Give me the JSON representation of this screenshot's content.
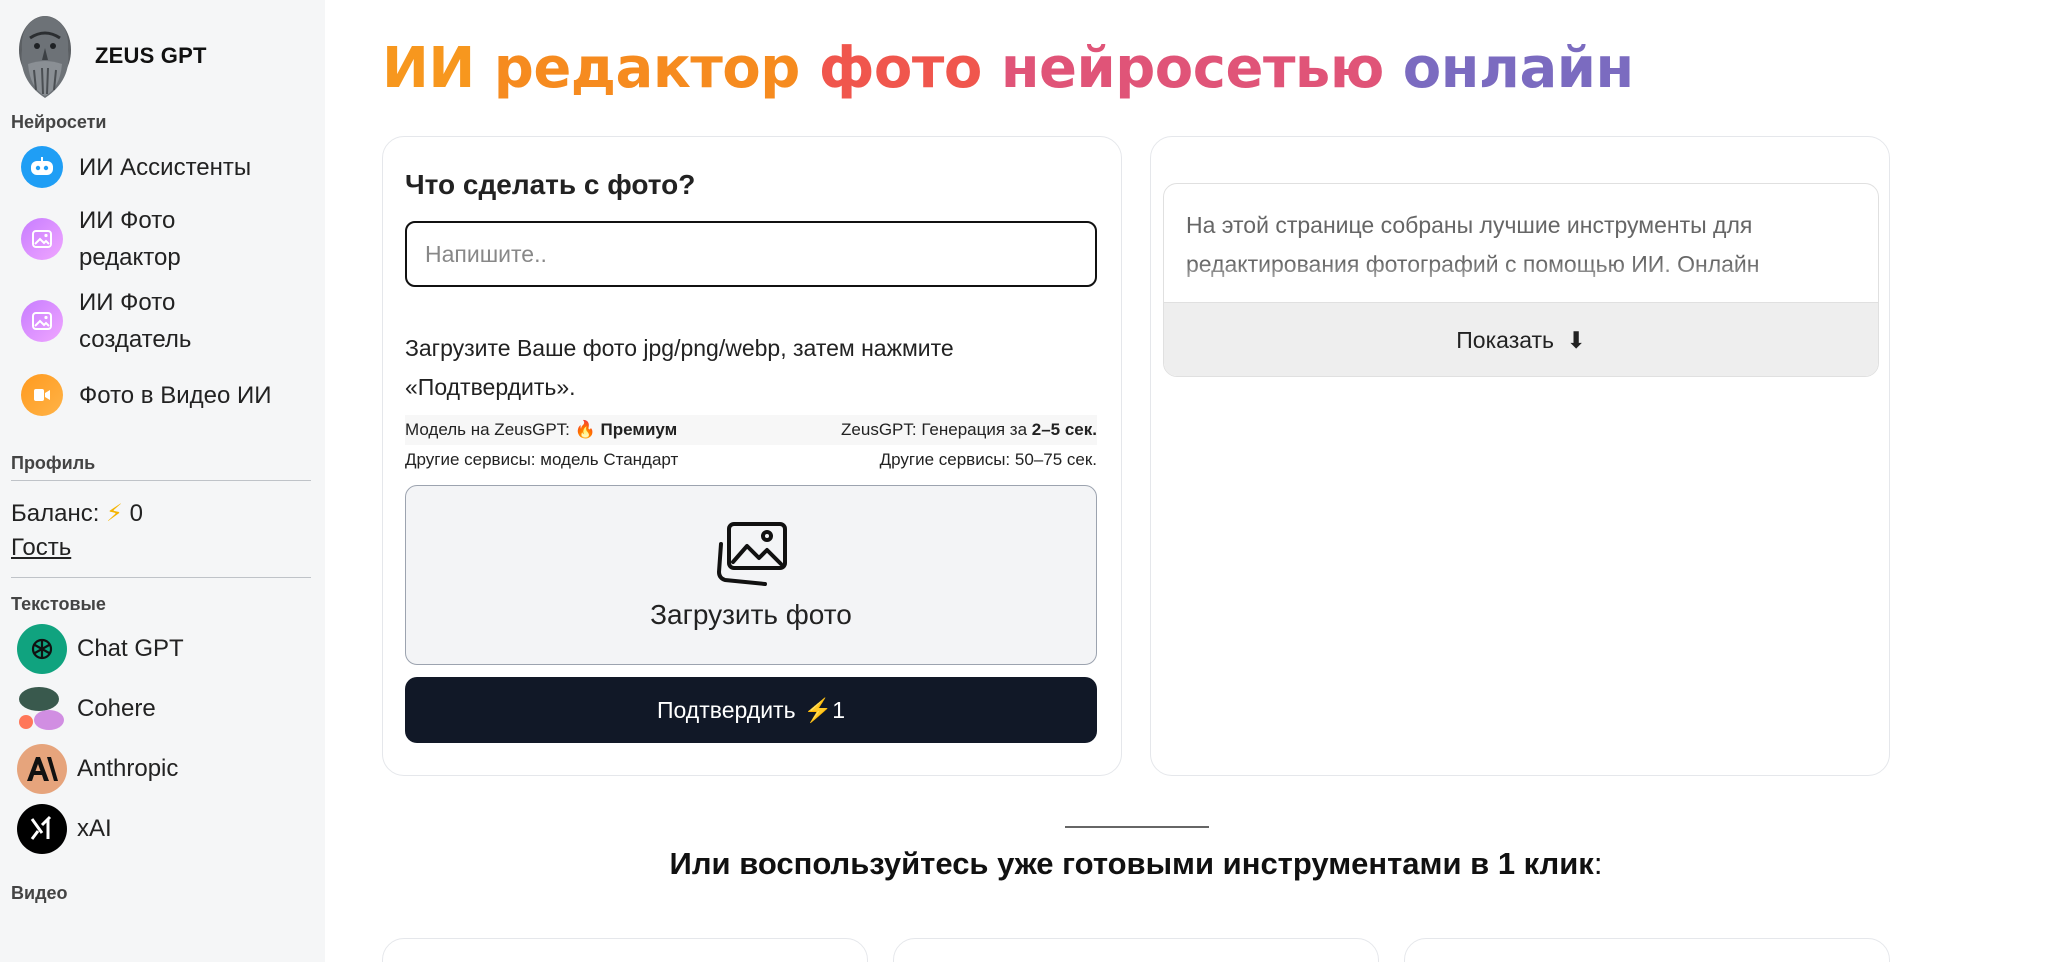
{
  "brand": {
    "name": "ZEUS GPT"
  },
  "sidebar": {
    "sections": {
      "neural": "Нейросети",
      "profile": "Профиль",
      "text": "Текстовые",
      "video": "Видео"
    },
    "nav": [
      {
        "label": "ИИ Ассистенты",
        "icon": "robot-icon"
      },
      {
        "label": "ИИ Фото редактор",
        "icon": "image-icon"
      },
      {
        "label": "ИИ Фото создатель",
        "icon": "image-icon"
      },
      {
        "label": "Фото в Видео ИИ",
        "icon": "video-icon"
      }
    ],
    "balance_label": "Баланс:",
    "balance_value": "0",
    "guest": "Гость",
    "tools": [
      {
        "label": "Chat GPT",
        "icon": "openai-icon"
      },
      {
        "label": "Cohere",
        "icon": "cohere-icon"
      },
      {
        "label": "Anthropic",
        "icon": "anthropic-icon"
      },
      {
        "label": "xAI",
        "icon": "xai-icon"
      }
    ]
  },
  "hero": {
    "words": [
      "ИИ",
      "редактор",
      "фото",
      "нейросетью",
      "онлайн"
    ]
  },
  "editor": {
    "question": "Что сделать с фото?",
    "placeholder": "Напишите..",
    "hint": "Загрузите Ваше фото jpg/png/webp, затем нажмите «Подтвердить».",
    "compare": {
      "row1_left": "Модель на ZeusGPT:",
      "row1_left_bold": "Премиум",
      "row1_right": "ZeusGPT: Генерация за",
      "row1_right_bold": "2–5 сек.",
      "row2_left": "Другие сервисы: модель Стандарт",
      "row2_right": "Другие сервисы: 50–75 сек."
    },
    "upload_label": "Загрузить фото",
    "confirm_label": "Подтвердить",
    "confirm_cost": "1"
  },
  "description": {
    "text": "На этой странице собраны лучшие инструменты для редактирования фотографий с помощью ИИ. Онлайн",
    "show_label": "Показать"
  },
  "tools_section": {
    "heading": "Или воспользуйтесь уже готовыми инструментами в 1 клик",
    "colon": ":"
  }
}
